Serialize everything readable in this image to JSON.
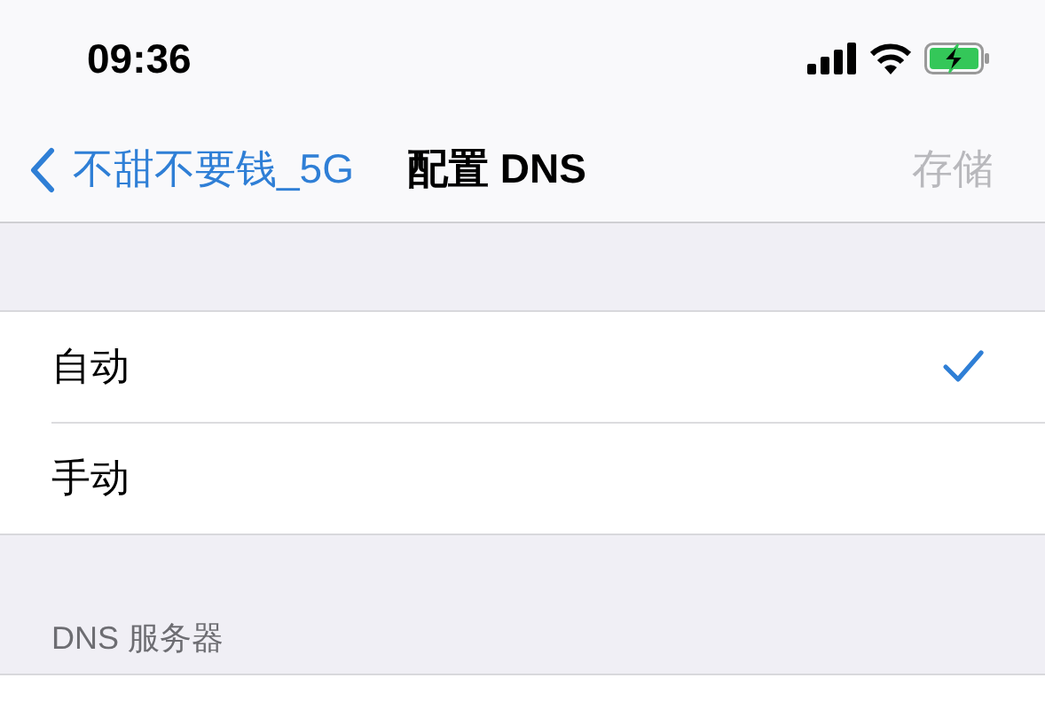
{
  "status_bar": {
    "time": "09:36"
  },
  "nav": {
    "back_label": "不甜不要钱_5G",
    "title": "配置 DNS",
    "save": {
      "label": "存储",
      "disabled": true
    }
  },
  "options": [
    {
      "label": "自动",
      "selected": true
    },
    {
      "label": "手动",
      "selected": false
    }
  ],
  "section_header": "DNS 服务器"
}
